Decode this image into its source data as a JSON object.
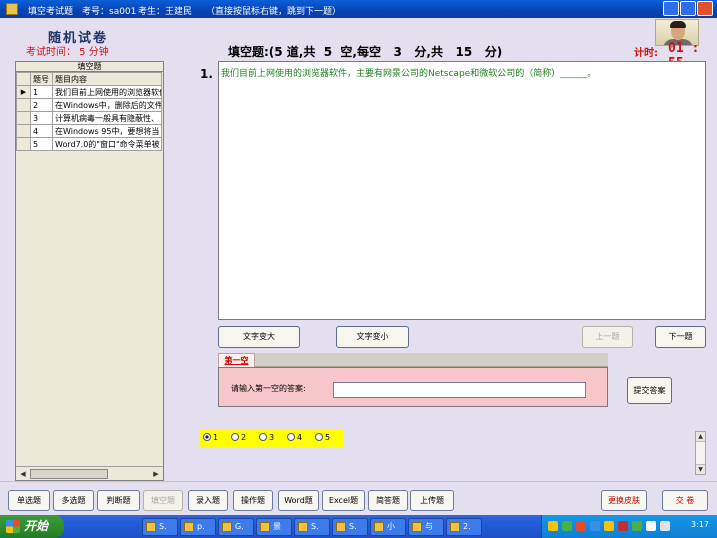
{
  "window": {
    "title": "填空考试题",
    "exam_id": "考号：sa001",
    "examinee": "考生：王建民",
    "hint": "（直接按鼠标右键，跳到下一题）"
  },
  "header": {
    "exam_title": "随机试卷",
    "exam_time": "考试时间： 5 分钟",
    "section_heading": "填空题:(5 道,共  5  空,每空   3   分,共   15   分)",
    "timer_label": "计时:",
    "timer_value": "01 : 55"
  },
  "question_list": {
    "caption": "填空题",
    "columns": [
      "题号",
      "题目内容"
    ],
    "rows": [
      {
        "num": "1",
        "content": "我们目前上网使用的浏览器软件",
        "current": true
      },
      {
        "num": "2",
        "content": "在Windows中，删除后的文件",
        "current": false
      },
      {
        "num": "3",
        "content": "计算机病毒一般具有隐蔽性、",
        "current": false
      },
      {
        "num": "4",
        "content": "在Windows 95中，要想将当",
        "current": false
      },
      {
        "num": "5",
        "content": "Word7.0的\"窗口\"命令菜单被",
        "current": false
      }
    ]
  },
  "question": {
    "number": "1.",
    "text": "我们目前上网使用的浏览器软件，主要有网景公司的Netscape和微软公司的（简称）______。"
  },
  "controls": {
    "font_bigger": "文字变大",
    "font_smaller": "文字变小",
    "prev": "上一题",
    "next": "下一题",
    "submit": "提交答案"
  },
  "answer": {
    "tab_label": "第一空",
    "prompt": "请输入第一空的答案:",
    "value": ""
  },
  "nav_radios": {
    "options": [
      "1",
      "2",
      "3",
      "4",
      "5"
    ],
    "selected": "1"
  },
  "categories": {
    "items": [
      "单选题",
      "多选题",
      "判断题",
      "填空题",
      "录入题",
      "操作题",
      "Word题",
      "Excel题",
      "简答题",
      "上传题"
    ],
    "active": "填空题",
    "change_skin": "更换皮肤",
    "submit_paper": "交 卷"
  },
  "taskbar": {
    "start": "开始",
    "buttons": [
      "S.",
      "p.",
      "G.",
      "景",
      "S.",
      "S.",
      "小",
      "与",
      "2."
    ],
    "clock": "3:17"
  }
}
